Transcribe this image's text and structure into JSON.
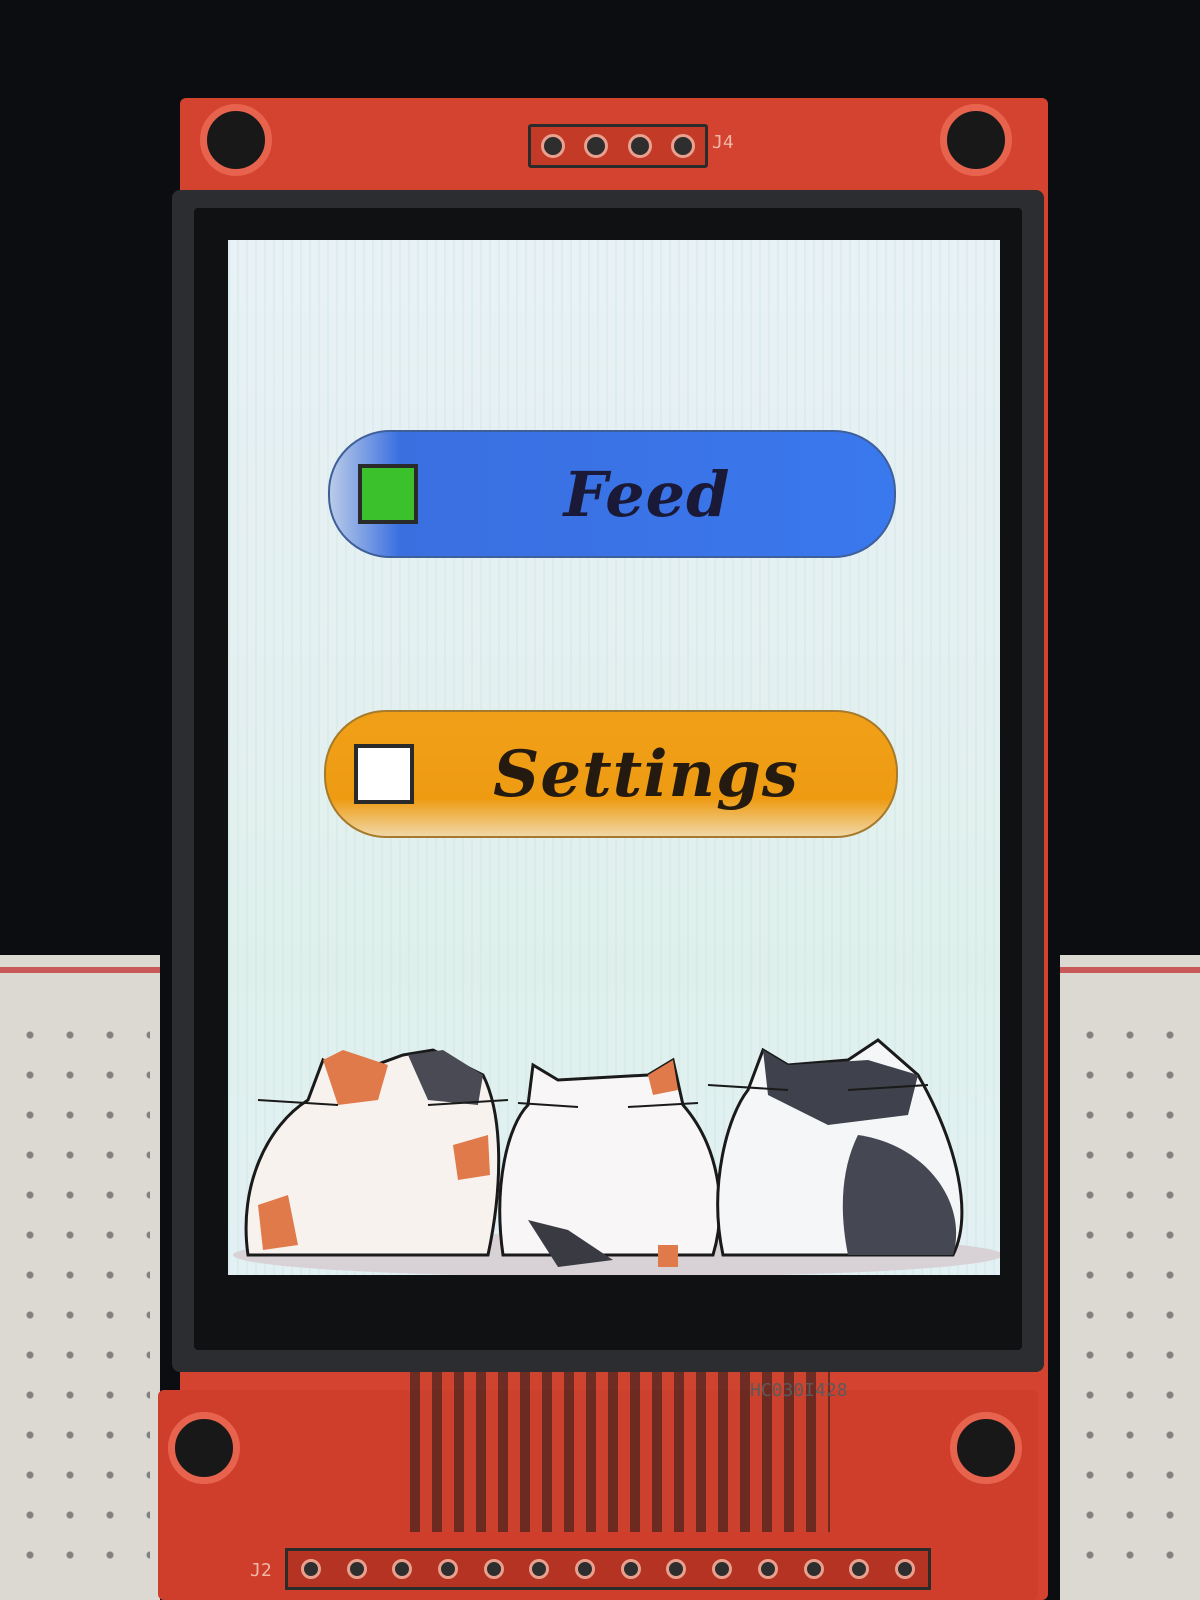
{
  "device": {
    "pcb_label_top": "J4",
    "pcb_label_bottom": "J2",
    "pcb_label_code": "HC030I428"
  },
  "screen": {
    "buttons": [
      {
        "label": "Feed",
        "checked": true,
        "color": "#3a78ee"
      },
      {
        "label": "Settings",
        "checked": false,
        "color": "#ee9b12"
      }
    ],
    "illustration": "three-cats-illustration",
    "checkbox_checked_color": "#3bc12b"
  }
}
